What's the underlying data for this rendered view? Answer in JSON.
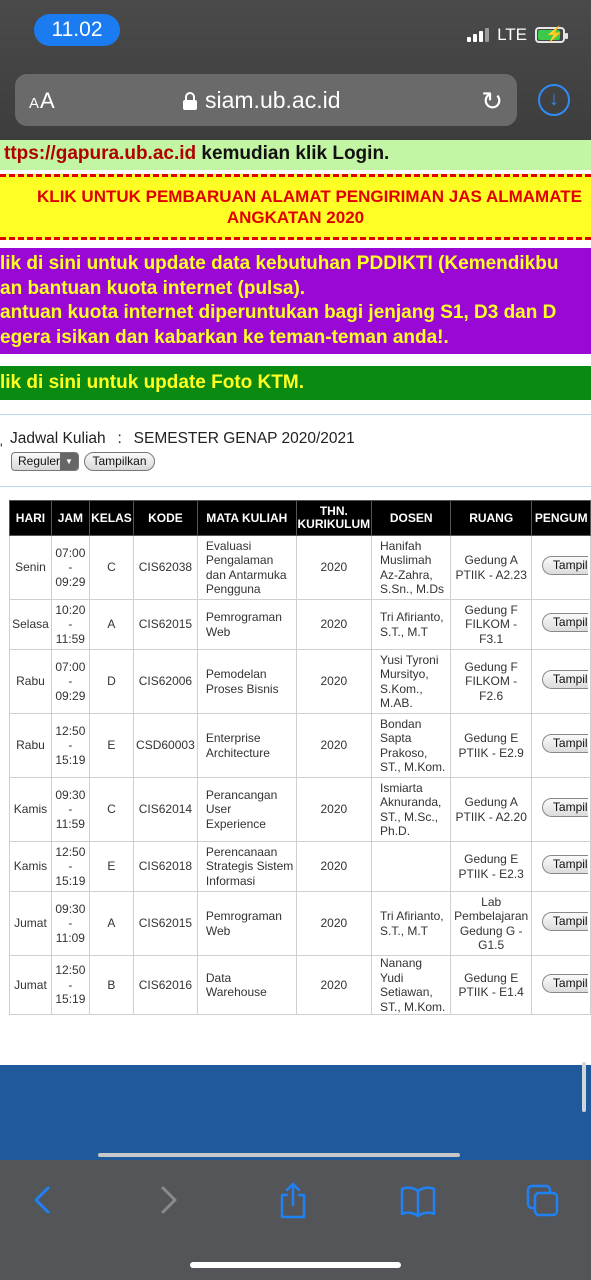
{
  "status_bar": {
    "time": "11.02",
    "network": "LTE"
  },
  "browser": {
    "text_size_label": "AA",
    "url": "siam.ub.ac.id"
  },
  "banners": {
    "login_link": "ttps://gapura.ub.ac.id",
    "login_rest": " kemudian klik Login.",
    "almamater_line1": "KLIK UNTUK PEMBARUAN ALAMAT PENGIRIMAN JAS ALMAMATE",
    "almamater_line2": "ANGKATAN 2020",
    "pddikti_line1": "lik di sini untuk update data kebutuhan PDDIKTI (Kemendikbu",
    "pddikti_line2": "an bantuan kuota internet (pulsa).",
    "pddikti_line3": "antuan kuota internet diperuntukan bagi jenjang S1, D3 dan D",
    "pddikti_line4": "egera isikan dan kabarkan ke teman-teman anda!.",
    "ktm": "lik di sini untuk update Foto KTM."
  },
  "schedule": {
    "label": "Jadwal Kuliah",
    "separator": ":",
    "semester": "SEMESTER GENAP 2020/2021",
    "program_select": "Reguler",
    "show_button": "Tampilkan",
    "columns": [
      "HARI",
      "JAM",
      "KELAS",
      "KODE",
      "MATA KULIAH",
      "THN. KURIKULUM",
      "DOSEN",
      "RUANG",
      "PENGUM"
    ],
    "row_action_label": "Tampilkan",
    "rows": [
      {
        "hari": "Senin",
        "jam": "07:00\n-\n09:29",
        "kelas": "C",
        "kode": "CIS62038",
        "mk": "Evaluasi Pengalaman dan Antarmuka Pengguna",
        "thn": "2020",
        "dosen": "Hanifah Muslimah Az-Zahra, S.Sn., M.Ds",
        "ruang": "Gedung A PTIIK - A2.23"
      },
      {
        "hari": "Selasa",
        "jam": "10:20\n-\n11:59",
        "kelas": "A",
        "kode": "CIS62015",
        "mk": "Pemrograman Web",
        "thn": "2020",
        "dosen": "Tri Afirianto, S.T., M.T",
        "ruang": "Gedung F FILKOM - F3.1"
      },
      {
        "hari": "Rabu",
        "jam": "07:00\n-\n09:29",
        "kelas": "D",
        "kode": "CIS62006",
        "mk": "Pemodelan Proses Bisnis",
        "thn": "2020",
        "dosen": "Yusi Tyroni Mursityo, S.Kom., M.AB.",
        "ruang": "Gedung F FILKOM - F2.6"
      },
      {
        "hari": "Rabu",
        "jam": "12:50\n-\n15:19",
        "kelas": "E",
        "kode": "CSD60003",
        "mk": "Enterprise Architecture",
        "thn": "2020",
        "dosen": "Bondan Sapta Prakoso, ST., M.Kom.",
        "ruang": "Gedung E PTIIK - E2.9"
      },
      {
        "hari": "Kamis",
        "jam": "09:30\n-\n11:59",
        "kelas": "C",
        "kode": "CIS62014",
        "mk": "Perancangan User Experience",
        "thn": "2020",
        "dosen": "Ismiarta Aknuranda, ST., M.Sc., Ph.D.",
        "ruang": "Gedung A PTIIK - A2.20"
      },
      {
        "hari": "Kamis",
        "jam": "12:50\n-\n15:19",
        "kelas": "E",
        "kode": "CIS62018",
        "mk": "Perencanaan Strategis Sistem Informasi",
        "thn": "2020",
        "dosen": "",
        "ruang": "Gedung E PTIIK - E2.3"
      },
      {
        "hari": "Jumat",
        "jam": "09:30\n-\n11:09",
        "kelas": "A",
        "kode": "CIS62015",
        "mk": "Pemrograman Web",
        "thn": "2020",
        "dosen": "Tri Afirianto, S.T., M.T",
        "ruang": "Lab Pembelajaran Gedung G - G1.5"
      },
      {
        "hari": "Jumat",
        "jam": "12:50\n-\n15:19",
        "kelas": "B",
        "kode": "CIS62016",
        "mk": "Data Warehouse",
        "thn": "2020",
        "dosen": "Nanang Yudi Setiawan, ST., M.Kom.",
        "ruang": "Gedung E PTIIK - E1.4"
      }
    ]
  },
  "colors": {
    "accent_blue": "#1e82f6",
    "banner_red": "#e00000",
    "banner_purple": "#9a08d6",
    "banner_green": "#0b8a12"
  }
}
